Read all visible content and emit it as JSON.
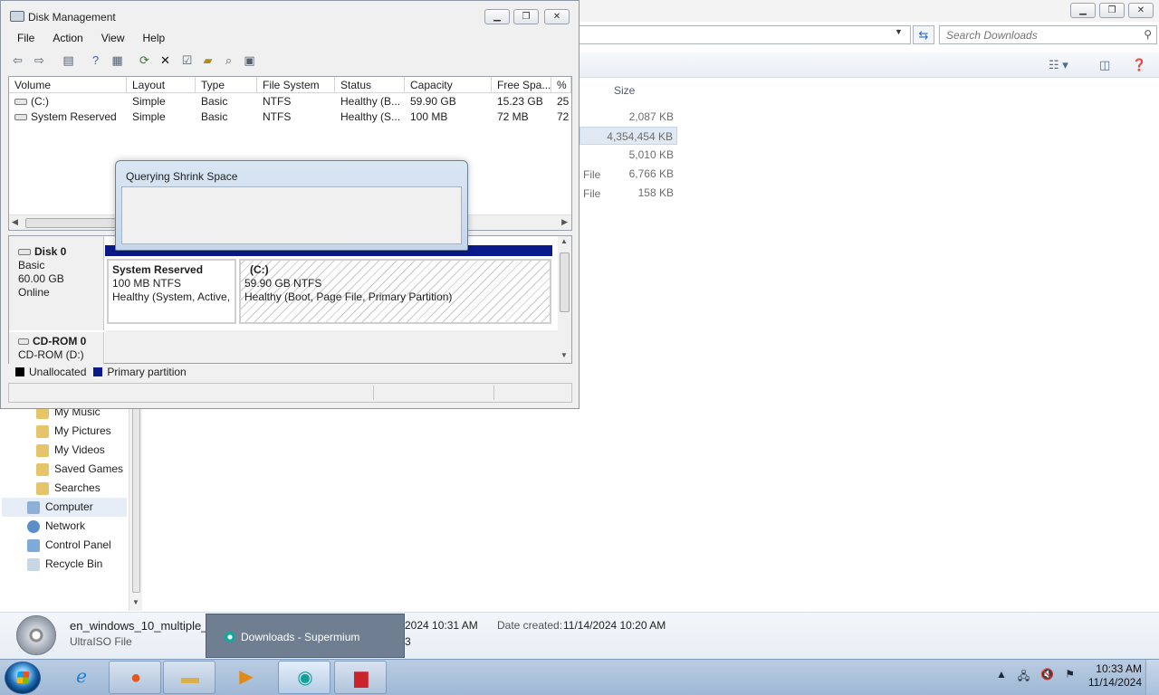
{
  "explorer": {
    "search_placeholder": "Search Downloads",
    "column_size": "Size",
    "size_rows": [
      "2,087 KB",
      "4,354,454 KB",
      "5,010 KB",
      "6,766 KB",
      "158 KB"
    ],
    "type_fragments": [
      "File",
      "File"
    ],
    "nav": [
      "My Music",
      "My Pictures",
      "My Videos",
      "Saved Games",
      "Searches",
      "Computer",
      "Network",
      "Control Panel",
      "Recycle Bin"
    ],
    "details": {
      "file_name": "en_windows_10_multiple_e",
      "file_type": "UltraISO File",
      "modified_frag": "2024 10:31 AM",
      "created_label": "Date created:",
      "created_value": "11/14/2024 10:20 AM",
      "frag_b": "3"
    }
  },
  "diskmgmt": {
    "title": "Disk Management",
    "menu": [
      "File",
      "Action",
      "View",
      "Help"
    ],
    "columns": [
      "Volume",
      "Layout",
      "Type",
      "File System",
      "Status",
      "Capacity",
      "Free Spa...",
      "% F"
    ],
    "rows": [
      [
        "(C:)",
        "Simple",
        "Basic",
        "NTFS",
        "Healthy (B...",
        "59.90 GB",
        "15.23 GB",
        "25"
      ],
      [
        "System Reserved",
        "Simple",
        "Basic",
        "NTFS",
        "Healthy (S...",
        "100 MB",
        "72 MB",
        "72"
      ]
    ],
    "disk0": {
      "name": "Disk 0",
      "kind": "Basic",
      "size": "60.00 GB",
      "state": "Online",
      "partitions": [
        {
          "name": "System Reserved",
          "size": "100 MB NTFS",
          "status": "Healthy (System, Active,"
        },
        {
          "name": "(C:)",
          "size": "59.90 GB NTFS",
          "status": "Healthy (Boot, Page File, Primary Partition)"
        }
      ]
    },
    "cdrom": {
      "name": "CD-ROM 0",
      "drive": "CD-ROM (D:)"
    },
    "legend": [
      {
        "label": "Unallocated",
        "color": "#000000"
      },
      {
        "label": "Primary partition",
        "color": "#0a1a8a"
      }
    ]
  },
  "dialog": {
    "title": "Querying Shrink Space"
  },
  "taskbar": {
    "popup_label": "Downloads - Supermium",
    "clock_time": "10:33 AM",
    "clock_date": "11/14/2024"
  }
}
